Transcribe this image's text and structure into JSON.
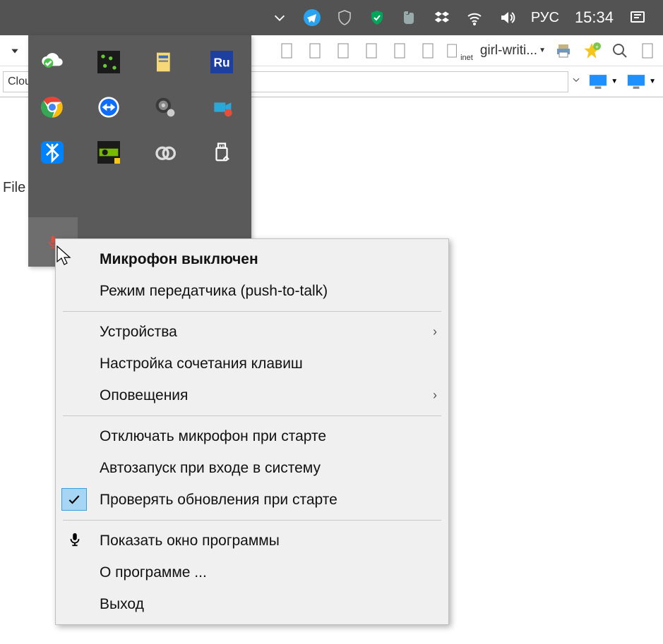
{
  "taskbar": {
    "lang": "РУС",
    "clock": "15:34"
  },
  "toolbar": {
    "inet": "inet",
    "filename": "girl-writi..."
  },
  "addrbar": {
    "text": "Clou"
  },
  "filelabel": "File",
  "context_menu": {
    "mic_off": "Микрофон выключен",
    "ptt": "Режим передатчика (push-to-talk)",
    "devices": "Устройства",
    "hotkeys": "Настройка сочетания клавиш",
    "notify": "Оповещения",
    "mute_on_start": "Отключать микрофон при старте",
    "autostart": "Автозапуск при входе в систему",
    "check_updates": "Проверять обновления при старте",
    "show_window": "Показать окно программы",
    "about": "О программе ...",
    "exit": "Выход"
  },
  "colors": {
    "taskbar": "#535353",
    "tray": "#5A5A5A",
    "check_bg": "#a7d6f5"
  }
}
